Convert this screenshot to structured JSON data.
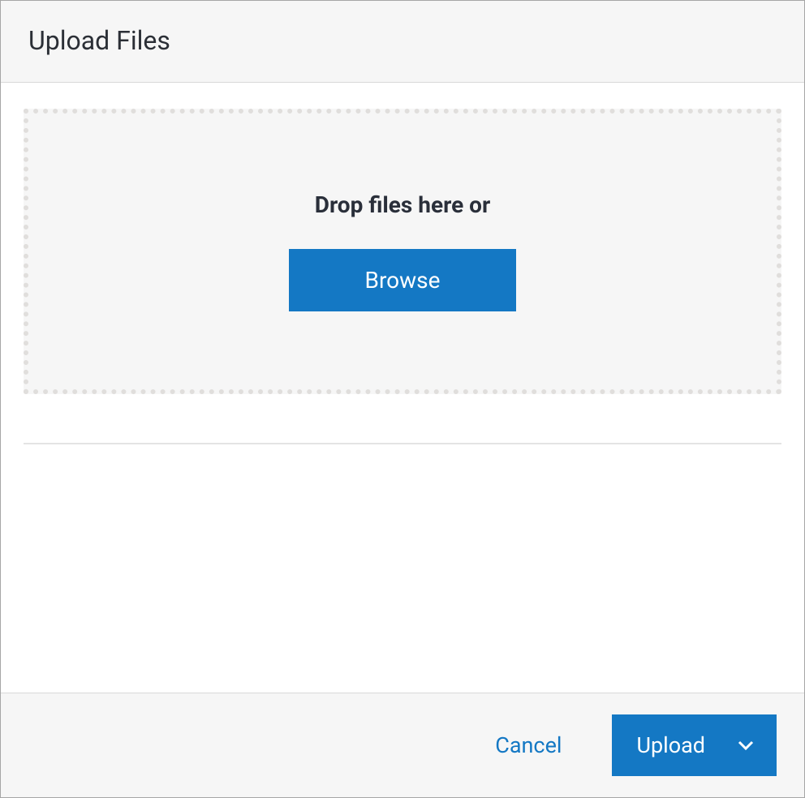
{
  "dialog": {
    "title": "Upload Files"
  },
  "dropzone": {
    "text": "Drop files here or",
    "browse_label": "Browse"
  },
  "footer": {
    "cancel_label": "Cancel",
    "upload_label": "Upload"
  }
}
